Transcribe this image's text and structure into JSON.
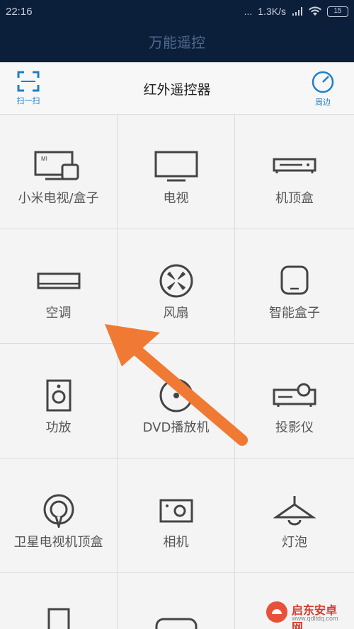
{
  "status": {
    "time": "22:16",
    "dots": "...",
    "speed": "1.3K/s",
    "battery": "15"
  },
  "app_title": "万能遥控",
  "toolbar": {
    "title": "红外遥控器",
    "scan_label": "扫一扫",
    "nearby_label": "周边"
  },
  "devices": [
    {
      "label": "小米电视/盒子",
      "icon": "mi-tv-box-icon"
    },
    {
      "label": "电视",
      "icon": "tv-icon"
    },
    {
      "label": "机顶盒",
      "icon": "set-top-box-icon"
    },
    {
      "label": "空调",
      "icon": "air-conditioner-icon"
    },
    {
      "label": "风扇",
      "icon": "fan-icon"
    },
    {
      "label": "智能盒子",
      "icon": "smart-box-icon"
    },
    {
      "label": "功放",
      "icon": "amplifier-icon"
    },
    {
      "label": "DVD播放机",
      "icon": "dvd-icon"
    },
    {
      "label": "投影仪",
      "icon": "projector-icon"
    },
    {
      "label": "卫星电视机顶盒",
      "icon": "satellite-box-icon"
    },
    {
      "label": "相机",
      "icon": "camera-icon"
    },
    {
      "label": "灯泡",
      "icon": "lamp-icon"
    }
  ],
  "watermark": {
    "brand": "启东安卓网",
    "url": "www.qdltdq.com"
  },
  "colors": {
    "header_bg": "#0b1e3a",
    "accent": "#1e7fc8",
    "arrow": "#f07a33"
  }
}
